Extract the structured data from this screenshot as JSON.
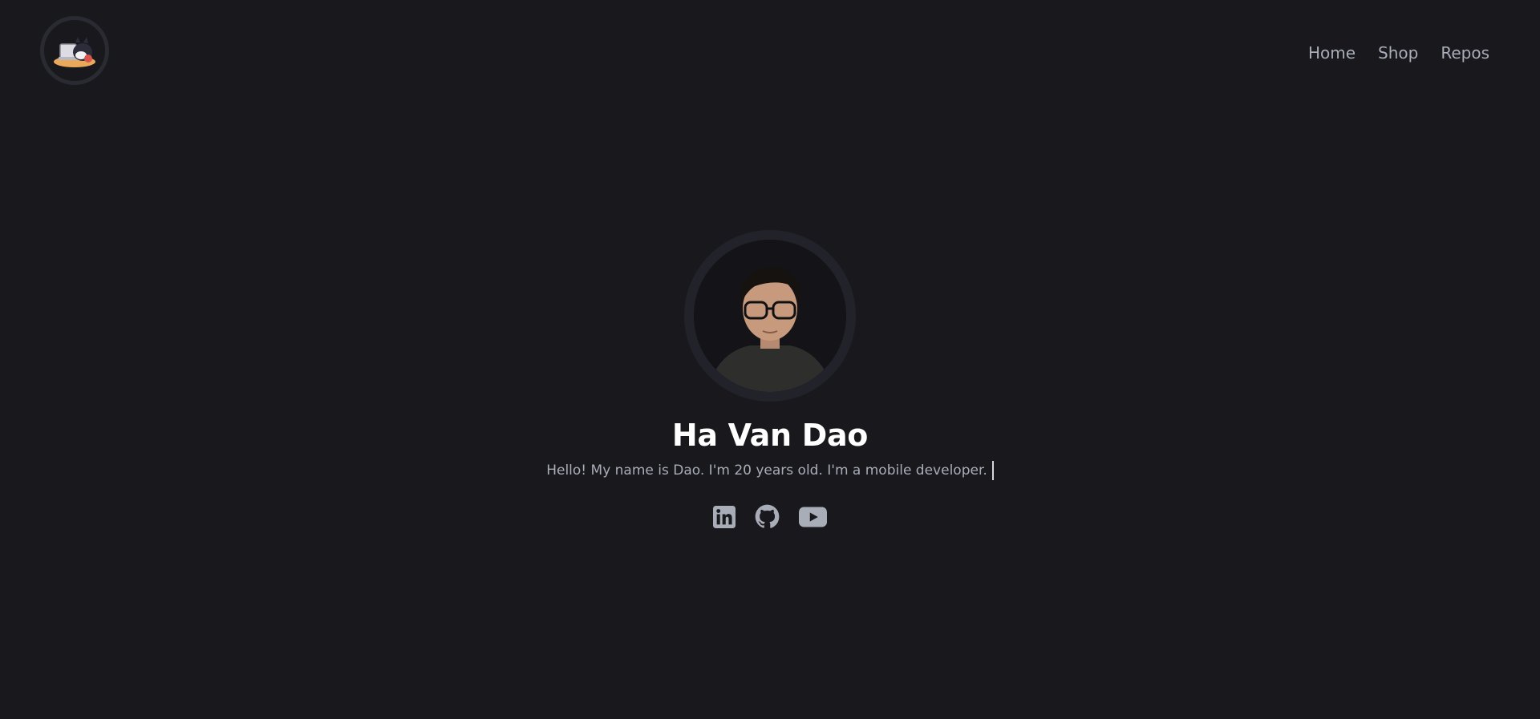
{
  "header": {
    "logo_icon": "cat-laptop-logo-icon",
    "nav": [
      {
        "label": "Home"
      },
      {
        "label": "Shop"
      },
      {
        "label": "Repos"
      }
    ]
  },
  "hero": {
    "avatar_icon": "profile-photo",
    "name": "Ha Van Dao",
    "bio": "Hello! My name is Dao. I'm 20 years old. I'm a mobile developer."
  },
  "socials": [
    {
      "icon": "linkedin-icon"
    },
    {
      "icon": "github-icon"
    },
    {
      "icon": "youtube-icon"
    }
  ],
  "colors": {
    "background": "#18181d",
    "text_muted": "#a9adb8",
    "text_primary": "#ffffff",
    "ring": "#2a2a33"
  }
}
